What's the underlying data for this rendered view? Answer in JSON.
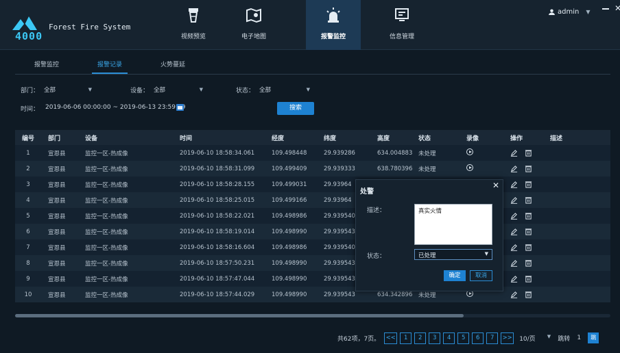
{
  "header": {
    "logo_text": "4000",
    "app_title": "Forest Fire System",
    "nav": [
      {
        "label": "视频预览",
        "icon": "fire-tower-icon",
        "active": false
      },
      {
        "label": "电子地图",
        "icon": "map-icon",
        "active": false
      },
      {
        "label": "报警监控",
        "icon": "alarm-light-icon",
        "active": true
      },
      {
        "label": "信息管理",
        "icon": "monitor-icon",
        "active": false
      }
    ],
    "user": "admin"
  },
  "tabs": [
    {
      "label": "报警监控",
      "active": false
    },
    {
      "label": "报警记录",
      "active": true
    },
    {
      "label": "火势蔓延",
      "active": false
    }
  ],
  "filters": {
    "dept_label": "部门：",
    "dept_value": "全部",
    "device_label": "设备：",
    "device_value": "全部",
    "status_label": "状态：",
    "status_value": "全部",
    "time_label": "时间：",
    "time_value": "2019-06-06 00:00:00 ~ 2019-06-13 23:59:59",
    "search_label": "搜索"
  },
  "table": {
    "headers": [
      "编号",
      "部门",
      "设备",
      "时间",
      "经度",
      "纬度",
      "高度",
      "状态",
      "录像",
      "操作",
      "描述"
    ],
    "rows": [
      [
        "1",
        "宣恩县",
        "监控一区-热成像",
        "2019-06-10 18:58:34.061",
        "109.498448",
        "29.939286",
        "634.004883",
        "未处理"
      ],
      [
        "2",
        "宣恩县",
        "监控一区-热成像",
        "2019-06-10 18:58:31.099",
        "109.499409",
        "29.939333",
        "638.780396",
        "未处理"
      ],
      [
        "3",
        "宣恩县",
        "监控一区-热成像",
        "2019-06-10 18:58:28.155",
        "109.499031",
        "29.93964",
        "",
        ""
      ],
      [
        "4",
        "宣恩县",
        "监控一区-热成像",
        "2019-06-10 18:58:25.015",
        "109.499166",
        "29.93964",
        "",
        ""
      ],
      [
        "5",
        "宣恩县",
        "监控一区-热成像",
        "2019-06-10 18:58:22.021",
        "109.498986",
        "29.939540",
        "",
        ""
      ],
      [
        "6",
        "宣恩县",
        "监控一区-热成像",
        "2019-06-10 18:58:19.014",
        "109.498990",
        "29.939543",
        "",
        ""
      ],
      [
        "7",
        "宣恩县",
        "监控一区-热成像",
        "2019-06-10 18:58:16.604",
        "109.498986",
        "29.939540",
        "",
        ""
      ],
      [
        "8",
        "宣恩县",
        "监控一区-热成像",
        "2019-06-10 18:57:50.231",
        "109.498990",
        "29.939543",
        "",
        ""
      ],
      [
        "9",
        "宣恩县",
        "监控一区-热成像",
        "2019-06-10 18:57:47.044",
        "109.498990",
        "29.939543",
        "",
        ""
      ],
      [
        "10",
        "宣恩县",
        "监控一区-热成像",
        "2019-06-10 18:57:44.029",
        "109.498990",
        "29.939543",
        "634.342896",
        "未处理"
      ]
    ]
  },
  "pagination": {
    "total_text": "共62项，7页。",
    "first": "<<",
    "pages": [
      "1",
      "2",
      "3",
      "4",
      "5",
      "6",
      "7"
    ],
    "last": ">>",
    "page_size": "10/页",
    "jump_label": "跳转",
    "jump_value": "1",
    "go_label": "跳"
  },
  "dialog": {
    "title": "处警",
    "desc_label": "描述：",
    "desc_value": "真实火情",
    "status_label": "状态：",
    "status_value": "已处理",
    "ok_label": "确定",
    "cancel_label": "取消"
  },
  "colors": {
    "accent": "#1e82d2",
    "active_nav": "#1d3a55",
    "background": "#0f1a24"
  }
}
